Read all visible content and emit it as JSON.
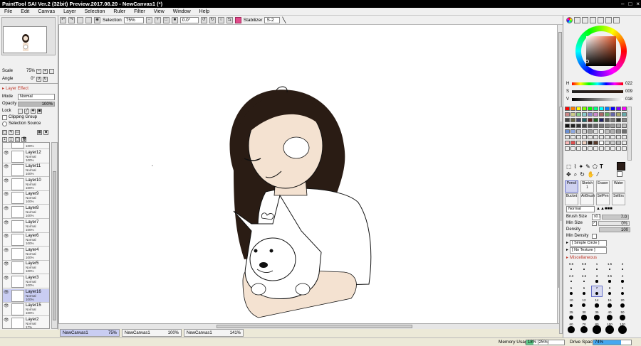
{
  "window": {
    "title": "PaintTool SAI Ver.2 (32bit) Preview.2017.08.20 - NewCanvas1 (*)",
    "controls": [
      "–",
      "□",
      "×"
    ]
  },
  "menu": [
    "File",
    "Edit",
    "Canvas",
    "Layer",
    "Selection",
    "Ruler",
    "Filter",
    "View",
    "Window",
    "Help"
  ],
  "toolbar": {
    "selection_label": "Selection",
    "zoom": "75%",
    "angle": "0.0°",
    "stabilizer_label": "Stabilizer",
    "stabilizer_value": "S-2"
  },
  "navigator": {
    "scale_label": "Scale",
    "scale_value": "75%",
    "angle_label": "Angle",
    "angle_value": "0°"
  },
  "layer_props": {
    "effect_label": "Layer Effect",
    "mode_label": "Mode",
    "mode_value": "Normal",
    "opacity_label": "Opacity",
    "opacity_value": "100%",
    "opacity_fraction": 1.0,
    "lock_label": "Lock",
    "clipping_label": "Clipping Group",
    "selection_source_label": "Selection Source"
  },
  "layers": [
    {
      "name": "",
      "mode": "",
      "opacity": "100%",
      "partial": true
    },
    {
      "name": "Layer12",
      "mode": "Normal",
      "opacity": "100%"
    },
    {
      "name": "Layer11",
      "mode": "Normal",
      "opacity": "100%"
    },
    {
      "name": "Layer10",
      "mode": "Normal",
      "opacity": "100%"
    },
    {
      "name": "Layer9",
      "mode": "Normal",
      "opacity": "100%"
    },
    {
      "name": "Layer8",
      "mode": "Normal",
      "opacity": "100%"
    },
    {
      "name": "Layer7",
      "mode": "Normal",
      "opacity": "100%"
    },
    {
      "name": "Layer6",
      "mode": "Normal",
      "opacity": "100%"
    },
    {
      "name": "Layer4",
      "mode": "Normal",
      "opacity": "100%"
    },
    {
      "name": "Layer5",
      "mode": "Normal",
      "opacity": "100%"
    },
    {
      "name": "Layer3",
      "mode": "Normal",
      "opacity": "100%"
    },
    {
      "name": "Layer16",
      "mode": "Normal",
      "opacity": "100%",
      "selected": true
    },
    {
      "name": "Layer15",
      "mode": "Normal",
      "opacity": "100%"
    },
    {
      "name": "Layer2",
      "mode": "Normal",
      "opacity": "17%"
    }
  ],
  "canvas_tabs": [
    {
      "name": "NewCanvas1",
      "zoom": "75%",
      "active": true
    },
    {
      "name": "NewCanvas1",
      "zoom": "100%"
    },
    {
      "name": "NewCanvas1",
      "zoom": "141%"
    }
  ],
  "status": {
    "memory_label": "Memory Usage",
    "memory_value": "18% (25%)",
    "memory_fraction": 0.18,
    "drive_label": "Drive Space",
    "drive_value": "74%",
    "drive_fraction": 0.74
  },
  "color": {
    "h_label": "H",
    "h_value": "022",
    "s_label": "S",
    "s_value": "009",
    "v_label": "V",
    "v_value": "018",
    "current": "#2b1d17",
    "hair": "#2a1c14",
    "skin": "#f4e2d1"
  },
  "tools_text": {
    "text_tool": "T"
  },
  "brush_tools": [
    {
      "name": "Pencil",
      "size": "",
      "active": true
    },
    {
      "name": "Sketch",
      "size": "1"
    },
    {
      "name": "Eraser",
      "size": ""
    },
    {
      "name": "Water",
      "size": ""
    },
    {
      "name": "Bucket",
      "size": ""
    },
    {
      "name": "AirBrush",
      "size": ""
    },
    {
      "name": "SelPen",
      "size": ""
    },
    {
      "name": "SelErs",
      "size": ""
    }
  ],
  "brush": {
    "mode": "Normal",
    "size_label": "Brush Size",
    "size_mult": "x0.1",
    "size_value": "7.0",
    "min_size_label": "Min Size",
    "min_size_value": "0%",
    "density_label": "Density",
    "density_value": "100",
    "min_density_label": "Min Density",
    "shape": "[ Simple Circle ]",
    "texture": "[ No Texture ]",
    "misc_label": "Miscellaneous"
  },
  "brush_sizes": [
    "0.6",
    "0.8",
    "1",
    "1.5",
    "2",
    "2.3",
    "2.6",
    "3",
    "3.5",
    "4",
    "5",
    "6",
    "7",
    "8",
    "9",
    "10",
    "12",
    "14",
    "16",
    "20",
    "25",
    "30",
    "35",
    "40",
    "50",
    "60",
    "70",
    "80",
    "100",
    "120"
  ]
}
